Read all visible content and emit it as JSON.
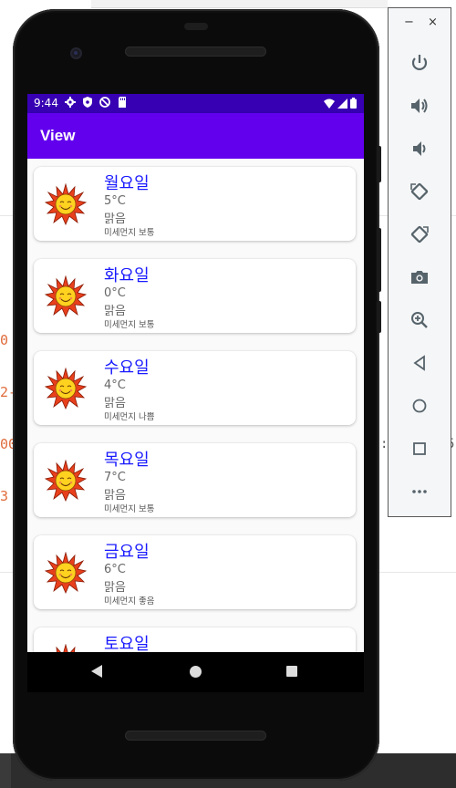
{
  "status_bar": {
    "time": "9:44"
  },
  "app_bar": {
    "title": "View"
  },
  "days": [
    {
      "day": "월요일",
      "temp": "5°C",
      "condition": "맑음",
      "dust": "미세먼지 보통"
    },
    {
      "day": "화요일",
      "temp": "0°C",
      "condition": "맑음",
      "dust": "미세먼지 보통"
    },
    {
      "day": "수요일",
      "temp": "4°C",
      "condition": "맑음",
      "dust": "미세먼지 나쁨"
    },
    {
      "day": "목요일",
      "temp": "7°C",
      "condition": "맑음",
      "dust": "미세먼지 보통"
    },
    {
      "day": "금요일",
      "temp": "6°C",
      "condition": "맑음",
      "dust": "미세먼지 좋음"
    },
    {
      "day": "토요일"
    }
  ],
  "emulator_panel": {
    "minimize": "−",
    "close": "×",
    "tools": [
      "power-icon",
      "volume-up-icon",
      "volume-down-icon",
      "rotate-left-icon",
      "rotate-right-icon",
      "camera-icon",
      "zoom-icon",
      "back-icon",
      "home-icon",
      "overview-icon",
      "more-icon"
    ]
  },
  "background_fragments": {
    "a": "0",
    "b": "2-",
    "c": "00",
    "d": "3",
    "e": ":5",
    "f": "5"
  },
  "colors": {
    "status_bar": "#3700b3",
    "app_bar": "#6200ee",
    "day_text": "#1a1aff"
  }
}
